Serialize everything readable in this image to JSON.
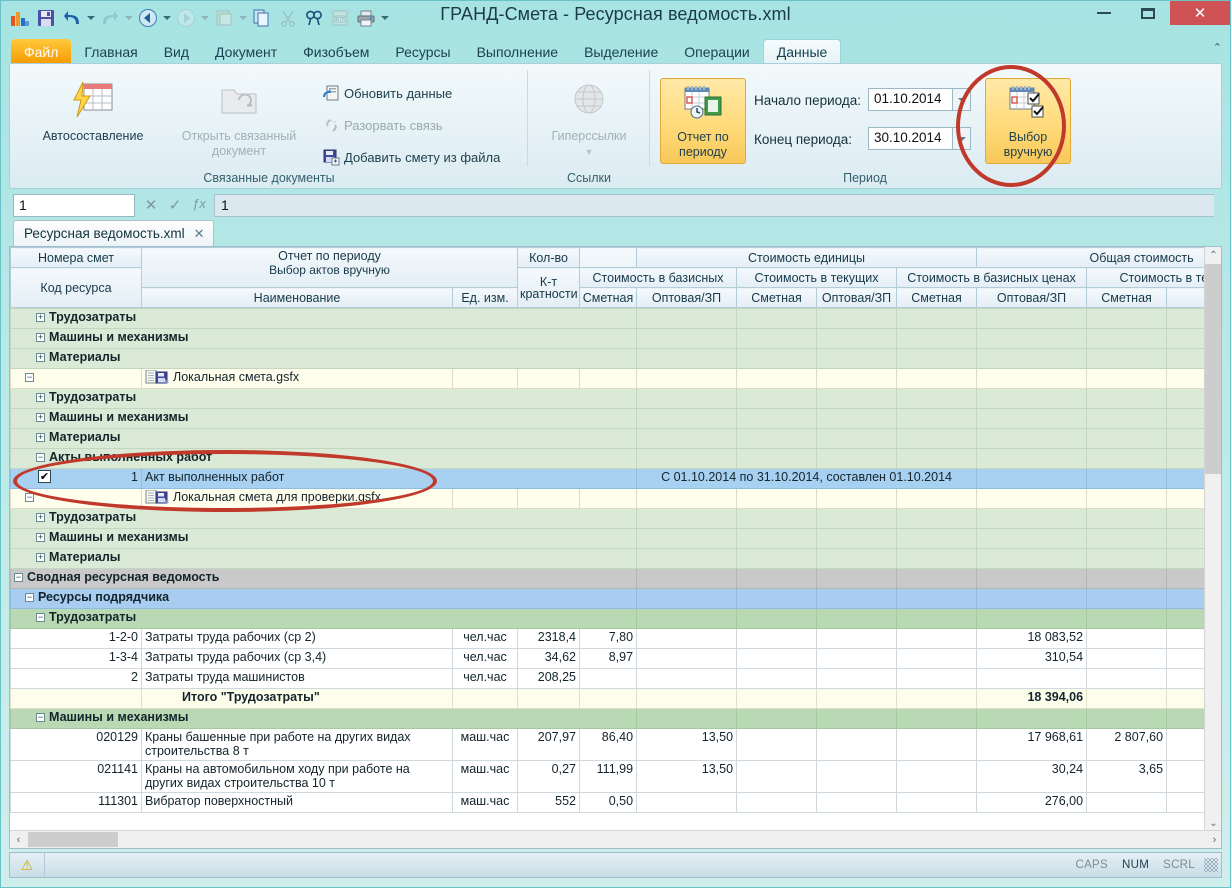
{
  "window": {
    "title": "ГРАНД-Смета - Ресурсная ведомость.xml",
    "minimize": "—",
    "maximize": "□",
    "close": "✕"
  },
  "quick_access": [
    {
      "name": "app-logo-icon",
      "glyph": "▮"
    },
    {
      "name": "save-icon",
      "glyph": "💾"
    },
    {
      "name": "undo-icon",
      "glyph": "↺"
    },
    {
      "name": "redo-icon",
      "glyph": "↻"
    },
    {
      "name": "back-icon",
      "glyph": "←"
    },
    {
      "name": "forward-icon",
      "glyph": "→"
    },
    {
      "name": "paste-icon",
      "glyph": "📋"
    },
    {
      "name": "copy-icon",
      "glyph": "⧉"
    },
    {
      "name": "cut-icon",
      "glyph": "✂"
    },
    {
      "name": "find-icon",
      "glyph": "🔍"
    },
    {
      "name": "rtf-icon",
      "glyph": "▤"
    },
    {
      "name": "print-icon",
      "glyph": "🖨"
    },
    {
      "name": "qat-more-icon",
      "glyph": "▾"
    }
  ],
  "ribbon_tabs": [
    {
      "label": "Файл",
      "active": false,
      "file": true
    },
    {
      "label": "Главная",
      "active": false
    },
    {
      "label": "Вид",
      "active": false
    },
    {
      "label": "Документ",
      "active": false
    },
    {
      "label": "Физобъем",
      "active": false
    },
    {
      "label": "Ресурсы",
      "active": false
    },
    {
      "label": "Выполнение",
      "active": false
    },
    {
      "label": "Выделение",
      "active": false
    },
    {
      "label": "Операции",
      "active": false
    },
    {
      "label": "Данные",
      "active": true
    }
  ],
  "ribbon": {
    "collapse_caret": "⌃",
    "group_linked_docs": {
      "label": "Связанные документы",
      "autocompose": "Автосоставление",
      "open_linked": "Открыть связанный документ",
      "refresh_data": "Обновить данные",
      "break_link": "Разорвать связь",
      "add_estimate": "Добавить смету из файла"
    },
    "group_links": {
      "label": "Ссылки",
      "hyperlinks": "Гиперссылки",
      "dropdown_caret": "▾"
    },
    "group_period": {
      "label": "Период",
      "report_by_period": "Отчет по периоду",
      "start_label": "Начало периода:",
      "start_value": "01.10.2014",
      "end_label": "Конец периода:",
      "end_value": "30.10.2014",
      "manual_select": "Выбор вручную"
    }
  },
  "formula_bar": {
    "name_box": "1",
    "cancel": "✕",
    "accept": "✓",
    "fx": "ƒx",
    "formula_value": "1"
  },
  "document_tab": {
    "label": "Ресурсная ведомость.xml",
    "close": "✕"
  },
  "grid": {
    "header": {
      "col_numbers": "Номера смет",
      "col_code": "Код ресурса",
      "report_title": "Отчет по периоду",
      "report_sub": "Выбор актов вручную",
      "name": "Наименование",
      "unit": "Ед. изм.",
      "qty": "Кол-во",
      "kt": "К-т кратности",
      "unit_cost": "Стоимость единицы",
      "total_cost": "Общая стоимость",
      "base_cost": "Стоимость в базисных",
      "current_cost": "Стоимость в текущих",
      "base_cost_total": "Стоимость в базисных ценах",
      "current_cost_total": "Стоимость в текущих",
      "smet": "Сметная",
      "opt": "Оптовая/ЗП",
      "opt_cut": "Опто"
    },
    "rows": [
      {
        "type": "grp",
        "indent": 2,
        "toggle": "+",
        "name": "Трудозатраты"
      },
      {
        "type": "grp",
        "indent": 2,
        "toggle": "+",
        "name": "Машины и механизмы"
      },
      {
        "type": "grp",
        "indent": 2,
        "toggle": "+",
        "name": "Материалы"
      },
      {
        "type": "doc",
        "indent": 1,
        "toggle": "−",
        "icon": "document-estimate-icon",
        "name": "Локальная смета.gsfx"
      },
      {
        "type": "grp",
        "indent": 2,
        "toggle": "+",
        "name": "Трудозатраты"
      },
      {
        "type": "grp",
        "indent": 2,
        "toggle": "+",
        "name": "Машины и механизмы"
      },
      {
        "type": "grp",
        "indent": 2,
        "toggle": "+",
        "name": "Материалы"
      },
      {
        "type": "grp",
        "indent": 2,
        "toggle": "−",
        "name": "Акты выполненных работ"
      },
      {
        "type": "sel",
        "indent": 0,
        "checkbox": true,
        "checked": true,
        "num": "1",
        "name": "Акт выполненных работ",
        "note": "С 01.10.2014 по 31.10.2014, составлен 01.10.2014"
      },
      {
        "type": "doc",
        "indent": 1,
        "toggle": "−",
        "icon": "document-estimate-icon",
        "name": "Локальная смета для проверки.gsfx"
      },
      {
        "type": "grp",
        "indent": 2,
        "toggle": "+",
        "name": "Трудозатраты"
      },
      {
        "type": "grp",
        "indent": 2,
        "toggle": "+",
        "name": "Машины и механизмы"
      },
      {
        "type": "grp",
        "indent": 2,
        "toggle": "+",
        "name": "Материалы"
      },
      {
        "type": "grp0",
        "indent": 0,
        "toggle": "−",
        "name": "Сводная ресурсная ведомость"
      },
      {
        "type": "grp1",
        "indent": 1,
        "toggle": "−",
        "name": "Ресурсы подрядчика"
      },
      {
        "type": "grp2",
        "indent": 2,
        "toggle": "−",
        "name": "Трудозатраты"
      },
      {
        "type": "dat",
        "code": "1-2-0",
        "name": "Затраты труда рабочих (ср 2)",
        "unit": "чел.час",
        "qty": "2318,4",
        "kt": "7,80",
        "c3": "",
        "c4": "",
        "c5": "18 083,52",
        "c6": "",
        "c7": "",
        "c8": ""
      },
      {
        "type": "dat",
        "code": "1-3-4",
        "name": "Затраты труда рабочих (ср 3,4)",
        "unit": "чел.час",
        "qty": "34,62",
        "kt": "8,97",
        "c3": "",
        "c4": "",
        "c5": "310,54",
        "c6": "",
        "c7": "",
        "c8": ""
      },
      {
        "type": "dat",
        "code": "2",
        "name": "Затраты труда машинистов",
        "unit": "чел.час",
        "qty": "208,25",
        "kt": "",
        "c3": "",
        "c4": "",
        "c5": "",
        "c6": "",
        "c7": "",
        "c8": ""
      },
      {
        "type": "tot",
        "code": "",
        "name": "Итого \"Трудозатраты\"",
        "unit": "",
        "qty": "",
        "kt": "",
        "c3": "",
        "c4": "",
        "c5": "18 394,06",
        "c6": "",
        "c7": "",
        "c8": ""
      },
      {
        "type": "grp2",
        "indent": 2,
        "toggle": "−",
        "name": "Машины и механизмы"
      },
      {
        "type": "dat",
        "tall": true,
        "code": "020129",
        "name": "Краны башенные при работе на других видах строительства 8 т",
        "unit": "маш.час",
        "qty": "207,97",
        "kt": "86,40",
        "c3": "13,50",
        "c4": "",
        "c5": "17 968,61",
        "c6": "2 807,60",
        "c7": "",
        "c8": ""
      },
      {
        "type": "dat",
        "tall": true,
        "code": "021141",
        "name": "Краны на автомобильном ходу при работе на других видах строительства 10 т",
        "unit": "маш.час",
        "qty": "0,27",
        "kt": "111,99",
        "c3": "13,50",
        "c4": "",
        "c5": "30,24",
        "c6": "3,65",
        "c7": "",
        "c8": ""
      },
      {
        "type": "dat",
        "code": "111301",
        "name": "Вибратор поверхностный",
        "unit": "маш.час",
        "qty": "552",
        "kt": "0,50",
        "c3": "",
        "c4": "",
        "c5": "276,00",
        "c6": "",
        "c7": "",
        "c8": ""
      }
    ],
    "scroll": {
      "up": "⌃",
      "down": "⌄",
      "left": "‹",
      "right": "›"
    }
  },
  "status_bar": {
    "warning_icon": "⚠",
    "message": "",
    "caps": "CAPS",
    "num": "NUM",
    "scrl": "SCRL"
  },
  "colors": {
    "accent": "#7fd3d4",
    "highlight": "#ffd977",
    "annotation": "#c0392b",
    "selection": "#a8d0f0",
    "group": "#dbead6"
  }
}
